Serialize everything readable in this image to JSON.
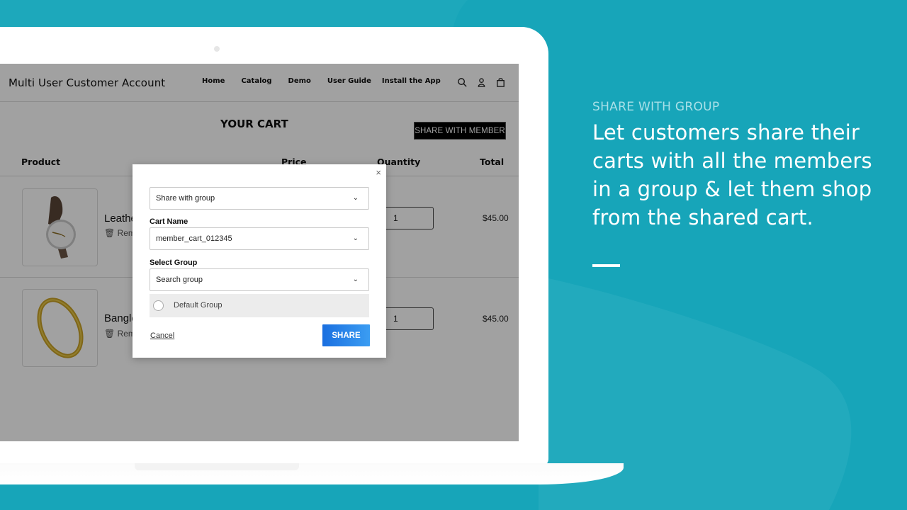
{
  "colors": {
    "background": "#17a5b9",
    "accent_button": "#2a86ea",
    "eyebrow_text": "#a9e0e8"
  },
  "site": {
    "title": "Multi User Customer Account",
    "nav": [
      "Home",
      "Catalog",
      "Demo",
      "User Guide",
      "Install  the App"
    ],
    "icons": [
      "search-icon",
      "account-icon",
      "shopping-bag-icon"
    ]
  },
  "cart": {
    "title": "YOUR CART",
    "share_member_label": "SHARE WITH MEMBER",
    "columns": [
      "Product",
      "Price",
      "Quantity",
      "Total"
    ],
    "items": [
      {
        "name": "Leather",
        "remove_label": "Remove",
        "quantity": "1",
        "total": "$45.00",
        "image": "watch"
      },
      {
        "name": "Bangle",
        "remove_label": "Remove",
        "quantity": "1",
        "total": "$45.00",
        "image": "bangle"
      }
    ]
  },
  "modal": {
    "close_label": "×",
    "share_type": "Share with group",
    "cart_name_label": "Cart Name",
    "cart_name_value": "member_cart_012345",
    "select_group_label": "Select Group",
    "search_group_placeholder": "Search group",
    "group_option": "Default Group",
    "cancel_label": "Cancel",
    "share_label": "SHARE"
  },
  "promo": {
    "eyebrow": "SHARE WITH GROUP",
    "headline": "Let customers share their carts with all the members in a group & let them shop from the shared cart."
  }
}
